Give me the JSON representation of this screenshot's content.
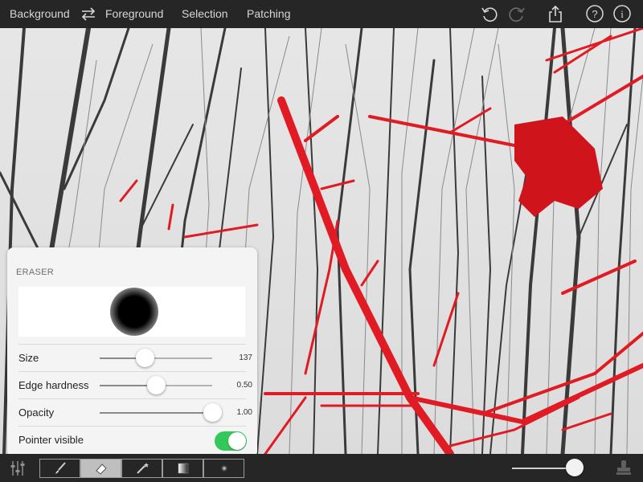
{
  "topbar": {
    "background_label": "Background",
    "foreground_label": "Foreground",
    "selection_label": "Selection",
    "patching_label": "Patching"
  },
  "eraser": {
    "title": "ERASER",
    "size_label": "Size",
    "size_value": "137",
    "size_level": 0.4,
    "edge_label": "Edge hardness",
    "edge_value": "0.50",
    "edge_level": 0.5,
    "opacity_label": "Opacity",
    "opacity_value": "1.00",
    "opacity_level": 1.0,
    "pointer_label": "Pointer visible",
    "pointer_on": true
  },
  "bottombar": {
    "tools": [
      "brush-tool",
      "eraser-tool",
      "magic-wand-tool",
      "gradient-tool",
      "soft-dot-tool"
    ],
    "active_tool": "eraser-tool",
    "zoom_level": 0.85
  },
  "colors": {
    "accent_red": "#e01b24",
    "toggle_on": "#34c759",
    "toolbar_bg": "#262626"
  }
}
